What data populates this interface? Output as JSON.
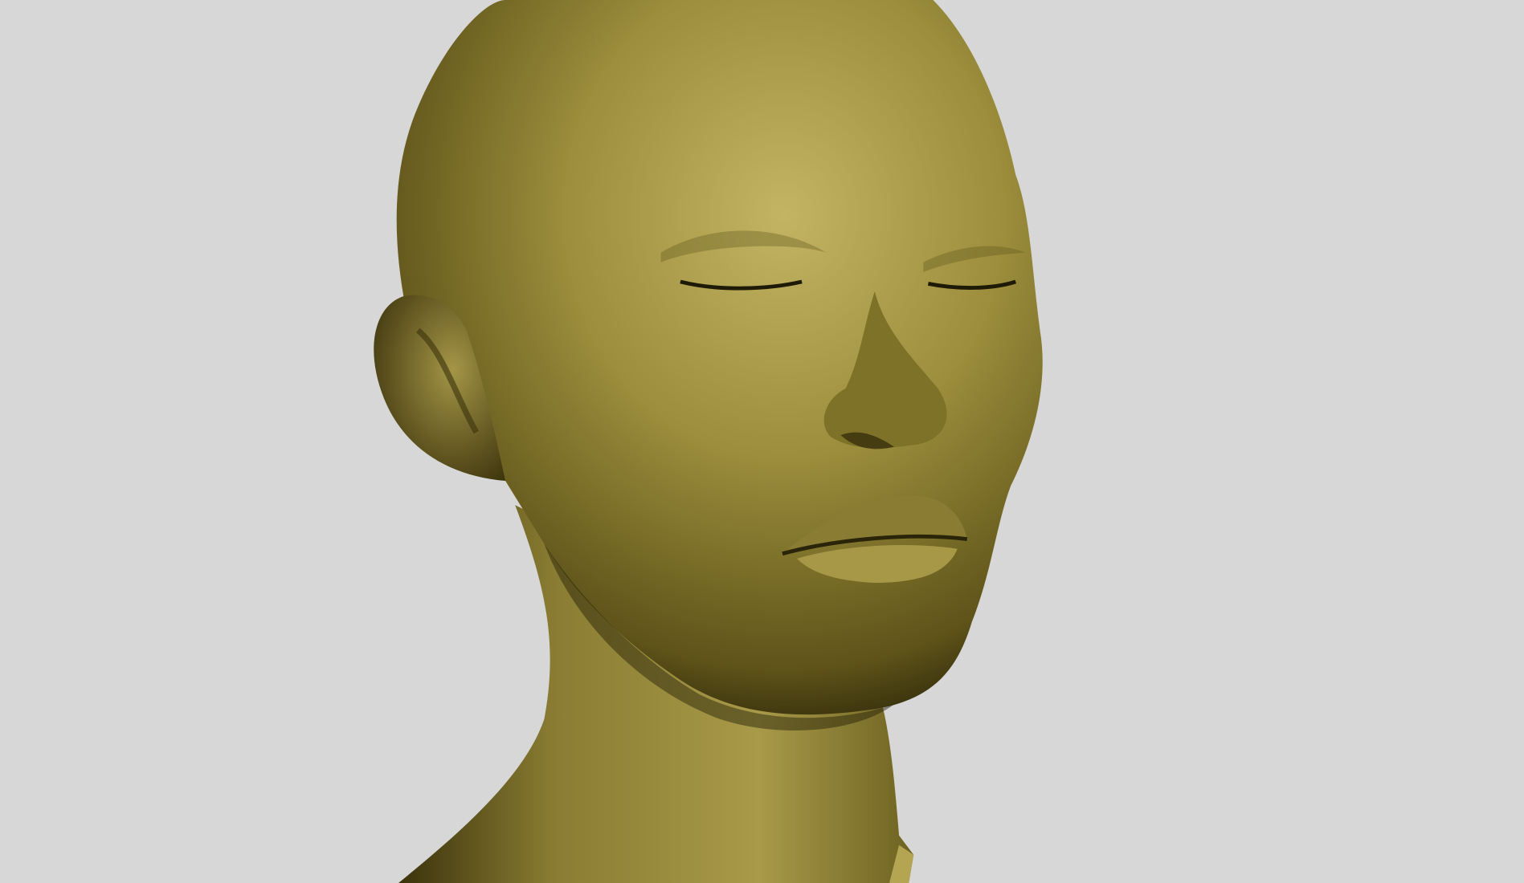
{
  "viewport": {
    "background_color": "#d7d7d7",
    "model": {
      "subject": "head-bust",
      "material_color": "#9c8e3c",
      "shadow_color": "#2a2408",
      "highlight_color": "#c2b463"
    }
  }
}
